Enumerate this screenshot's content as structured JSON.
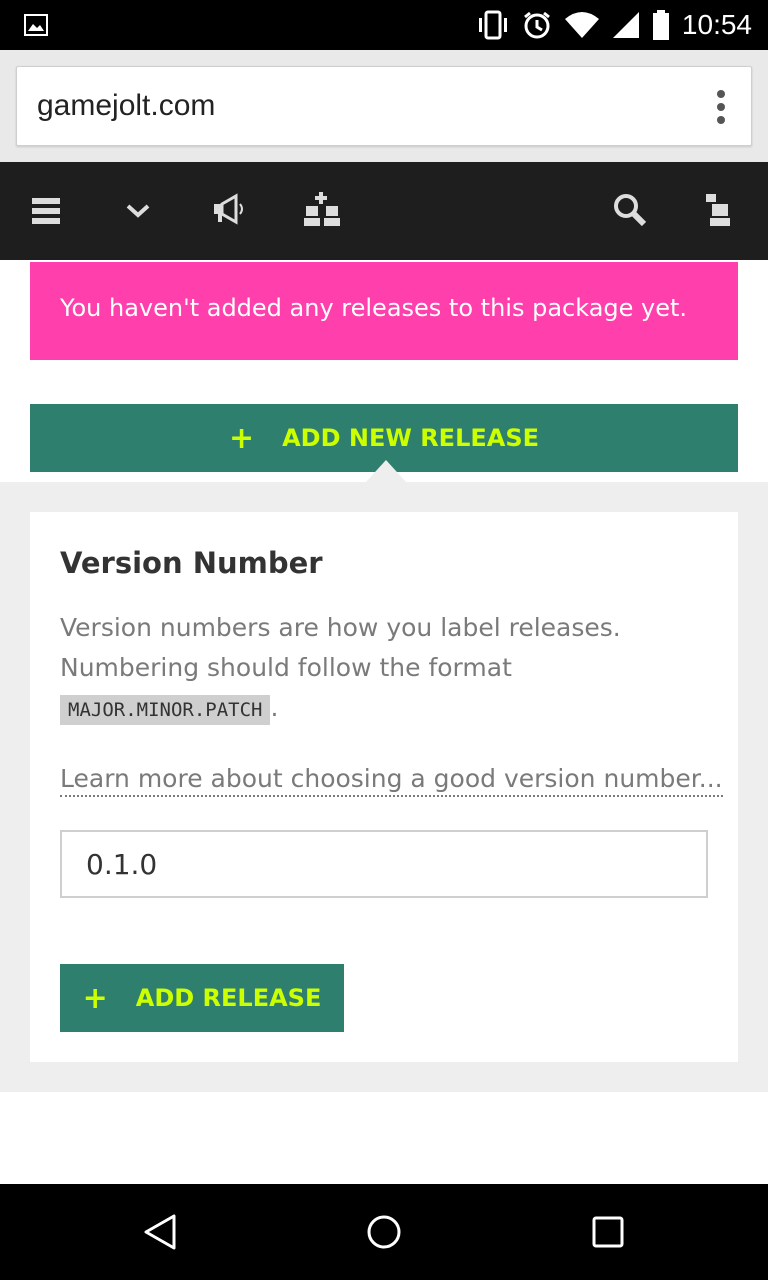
{
  "status_bar": {
    "time": "10:54",
    "icons": [
      "image-icon",
      "vibrate-icon",
      "alarm-icon",
      "wifi-icon",
      "signal-icon",
      "battery-icon"
    ]
  },
  "browser": {
    "url": "gamejolt.com",
    "menu_icon": "more-vert-icon"
  },
  "site_nav": {
    "icons": [
      "hamburger-menu-icon",
      "chevron-down-icon",
      "megaphone-icon",
      "add-friend-icon",
      "search-icon",
      "user-icon"
    ]
  },
  "alert": {
    "text": "You haven't added any releases to this package yet.",
    "color": "#ff3fac"
  },
  "add_new_release": {
    "plus": "+",
    "label": "ADD NEW RELEASE",
    "bg_color": "#2f7f6f",
    "text_color": "#ccff00"
  },
  "form": {
    "title": "Version Number",
    "description_line1": "Version numbers are how you label releases.",
    "description_line2": "Numbering should follow the format",
    "format_code": "MAJOR.MINOR.PATCH",
    "format_suffix": ".",
    "learn_more": "Learn more about choosing a good version number...",
    "version_value": "0.1.0"
  },
  "add_release": {
    "plus": "+",
    "label": "ADD RELEASE"
  },
  "android_nav": {
    "icons": [
      "back-icon",
      "home-icon",
      "recents-icon"
    ]
  }
}
